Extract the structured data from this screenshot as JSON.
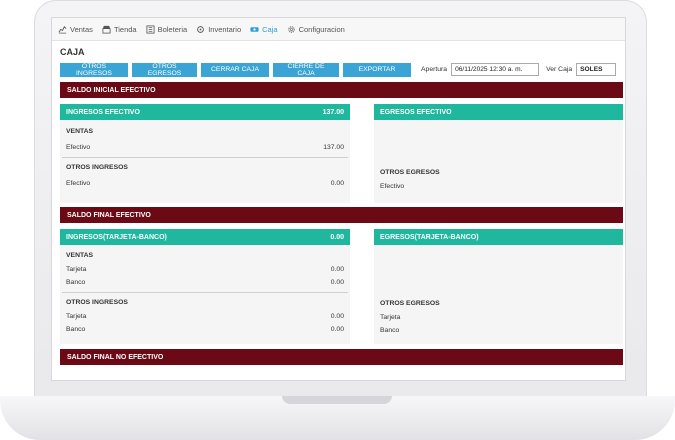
{
  "nav": {
    "items": [
      {
        "label": "Ventas",
        "icon": "chart-line-icon"
      },
      {
        "label": "Tienda",
        "icon": "store-icon"
      },
      {
        "label": "Boleteria",
        "icon": "ticket-icon"
      },
      {
        "label": "Inventario",
        "icon": "tools-icon"
      },
      {
        "label": "Caja",
        "icon": "cash-icon"
      },
      {
        "label": "Configuracion",
        "icon": "gear-icon"
      }
    ],
    "active_index": 4
  },
  "page": {
    "title": "CAJA"
  },
  "toolbar": {
    "buttons": [
      "OTROS INGRESOS",
      "OTROS EGRESOS",
      "CERRAR CAJA",
      "CIERRE DE CAJA",
      "EXPORTAR"
    ],
    "apertura_label": "Apertura",
    "apertura_value": "06/11/2025 12:30 a. m.",
    "ver_caja_label": "Ver Caja",
    "ver_caja_value": "SOLES"
  },
  "colors": {
    "section": "#6b0a14",
    "panel_head": "#1fb89e",
    "button": "#3aa4d4",
    "nav_active": "#2f9fd8"
  },
  "saldo_inicial": {
    "title": "SALDO INICIAL EFECTIVO",
    "ingresos": {
      "title": "INGRESOS EFECTIVO",
      "total": "137.00",
      "ventas_label": "VENTAS",
      "ventas_rows": [
        {
          "label": "Efectivo",
          "value": "137.00"
        }
      ],
      "otros_label": "OTROS INGRESOS",
      "otros_rows": [
        {
          "label": "Efectivo",
          "value": "0.00"
        }
      ]
    },
    "egresos": {
      "title": "EGRESOS EFECTIVO",
      "otros_label": "OTROS EGRESOS",
      "otros_rows": [
        {
          "label": "Efectivo"
        }
      ]
    }
  },
  "saldo_final": {
    "title": "SALDO FINAL EFECTIVO",
    "ingresos": {
      "title": "INGRESOS(TARJETA-BANCO)",
      "total": "0.00",
      "ventas_label": "VENTAS",
      "ventas_rows": [
        {
          "label": "Tarjeta",
          "value": "0.00"
        },
        {
          "label": "Banco",
          "value": "0.00"
        }
      ],
      "otros_label": "OTROS INGRESOS",
      "otros_rows": [
        {
          "label": "Tarjeta",
          "value": "0.00"
        },
        {
          "label": "Banco",
          "value": "0.00"
        }
      ]
    },
    "egresos": {
      "title": "EGRESOS(TARJETA-BANCO)",
      "otros_label": "OTROS EGRESOS",
      "otros_rows": [
        {
          "label": "Tarjeta"
        },
        {
          "label": "Banco"
        }
      ]
    }
  },
  "saldo_no_efectivo": {
    "title": "SALDO FINAL NO EFECTIVO"
  }
}
